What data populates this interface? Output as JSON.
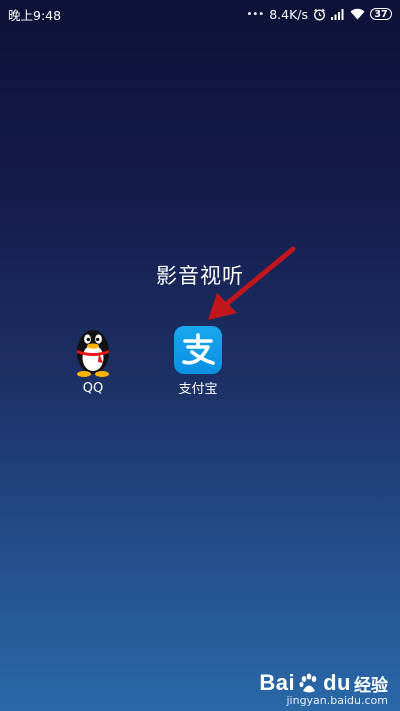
{
  "status_bar": {
    "time": "晚上9:48",
    "dots": "•••",
    "network_speed": "8.4K/s",
    "battery": "37",
    "icons": [
      "alarm-icon",
      "signal-icon",
      "wifi-icon",
      "battery-icon"
    ]
  },
  "folder": {
    "title": "影音视听",
    "apps": [
      {
        "label": "QQ",
        "icon": "qq-penguin-icon"
      },
      {
        "label": "支付宝",
        "icon": "alipay-icon",
        "glyph": "支",
        "color": "#1296e8"
      }
    ]
  },
  "annotation": {
    "color": "#c0161c"
  },
  "watermark": {
    "brand": "Bai",
    "brand_suffix": "du",
    "chinese": "经验",
    "url": "jingyan.baidu.com"
  }
}
